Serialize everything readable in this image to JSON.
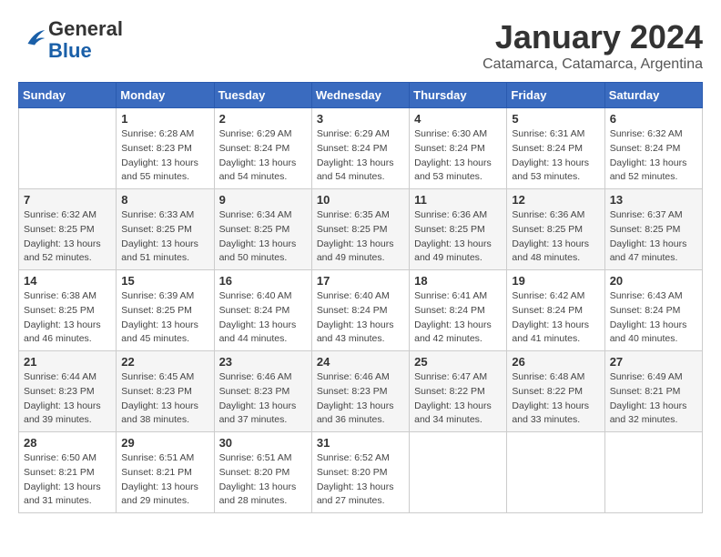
{
  "header": {
    "logo_general": "General",
    "logo_blue": "Blue",
    "title": "January 2024",
    "location": "Catamarca, Catamarca, Argentina"
  },
  "weekdays": [
    "Sunday",
    "Monday",
    "Tuesday",
    "Wednesday",
    "Thursday",
    "Friday",
    "Saturday"
  ],
  "weeks": [
    [
      {
        "day": "",
        "sunrise": "",
        "sunset": "",
        "daylight": ""
      },
      {
        "day": "1",
        "sunrise": "Sunrise: 6:28 AM",
        "sunset": "Sunset: 8:23 PM",
        "daylight": "Daylight: 13 hours and 55 minutes."
      },
      {
        "day": "2",
        "sunrise": "Sunrise: 6:29 AM",
        "sunset": "Sunset: 8:24 PM",
        "daylight": "Daylight: 13 hours and 54 minutes."
      },
      {
        "day": "3",
        "sunrise": "Sunrise: 6:29 AM",
        "sunset": "Sunset: 8:24 PM",
        "daylight": "Daylight: 13 hours and 54 minutes."
      },
      {
        "day": "4",
        "sunrise": "Sunrise: 6:30 AM",
        "sunset": "Sunset: 8:24 PM",
        "daylight": "Daylight: 13 hours and 53 minutes."
      },
      {
        "day": "5",
        "sunrise": "Sunrise: 6:31 AM",
        "sunset": "Sunset: 8:24 PM",
        "daylight": "Daylight: 13 hours and 53 minutes."
      },
      {
        "day": "6",
        "sunrise": "Sunrise: 6:32 AM",
        "sunset": "Sunset: 8:24 PM",
        "daylight": "Daylight: 13 hours and 52 minutes."
      }
    ],
    [
      {
        "day": "7",
        "sunrise": "Sunrise: 6:32 AM",
        "sunset": "Sunset: 8:25 PM",
        "daylight": "Daylight: 13 hours and 52 minutes."
      },
      {
        "day": "8",
        "sunrise": "Sunrise: 6:33 AM",
        "sunset": "Sunset: 8:25 PM",
        "daylight": "Daylight: 13 hours and 51 minutes."
      },
      {
        "day": "9",
        "sunrise": "Sunrise: 6:34 AM",
        "sunset": "Sunset: 8:25 PM",
        "daylight": "Daylight: 13 hours and 50 minutes."
      },
      {
        "day": "10",
        "sunrise": "Sunrise: 6:35 AM",
        "sunset": "Sunset: 8:25 PM",
        "daylight": "Daylight: 13 hours and 49 minutes."
      },
      {
        "day": "11",
        "sunrise": "Sunrise: 6:36 AM",
        "sunset": "Sunset: 8:25 PM",
        "daylight": "Daylight: 13 hours and 49 minutes."
      },
      {
        "day": "12",
        "sunrise": "Sunrise: 6:36 AM",
        "sunset": "Sunset: 8:25 PM",
        "daylight": "Daylight: 13 hours and 48 minutes."
      },
      {
        "day": "13",
        "sunrise": "Sunrise: 6:37 AM",
        "sunset": "Sunset: 8:25 PM",
        "daylight": "Daylight: 13 hours and 47 minutes."
      }
    ],
    [
      {
        "day": "14",
        "sunrise": "Sunrise: 6:38 AM",
        "sunset": "Sunset: 8:25 PM",
        "daylight": "Daylight: 13 hours and 46 minutes."
      },
      {
        "day": "15",
        "sunrise": "Sunrise: 6:39 AM",
        "sunset": "Sunset: 8:25 PM",
        "daylight": "Daylight: 13 hours and 45 minutes."
      },
      {
        "day": "16",
        "sunrise": "Sunrise: 6:40 AM",
        "sunset": "Sunset: 8:24 PM",
        "daylight": "Daylight: 13 hours and 44 minutes."
      },
      {
        "day": "17",
        "sunrise": "Sunrise: 6:40 AM",
        "sunset": "Sunset: 8:24 PM",
        "daylight": "Daylight: 13 hours and 43 minutes."
      },
      {
        "day": "18",
        "sunrise": "Sunrise: 6:41 AM",
        "sunset": "Sunset: 8:24 PM",
        "daylight": "Daylight: 13 hours and 42 minutes."
      },
      {
        "day": "19",
        "sunrise": "Sunrise: 6:42 AM",
        "sunset": "Sunset: 8:24 PM",
        "daylight": "Daylight: 13 hours and 41 minutes."
      },
      {
        "day": "20",
        "sunrise": "Sunrise: 6:43 AM",
        "sunset": "Sunset: 8:24 PM",
        "daylight": "Daylight: 13 hours and 40 minutes."
      }
    ],
    [
      {
        "day": "21",
        "sunrise": "Sunrise: 6:44 AM",
        "sunset": "Sunset: 8:23 PM",
        "daylight": "Daylight: 13 hours and 39 minutes."
      },
      {
        "day": "22",
        "sunrise": "Sunrise: 6:45 AM",
        "sunset": "Sunset: 8:23 PM",
        "daylight": "Daylight: 13 hours and 38 minutes."
      },
      {
        "day": "23",
        "sunrise": "Sunrise: 6:46 AM",
        "sunset": "Sunset: 8:23 PM",
        "daylight": "Daylight: 13 hours and 37 minutes."
      },
      {
        "day": "24",
        "sunrise": "Sunrise: 6:46 AM",
        "sunset": "Sunset: 8:23 PM",
        "daylight": "Daylight: 13 hours and 36 minutes."
      },
      {
        "day": "25",
        "sunrise": "Sunrise: 6:47 AM",
        "sunset": "Sunset: 8:22 PM",
        "daylight": "Daylight: 13 hours and 34 minutes."
      },
      {
        "day": "26",
        "sunrise": "Sunrise: 6:48 AM",
        "sunset": "Sunset: 8:22 PM",
        "daylight": "Daylight: 13 hours and 33 minutes."
      },
      {
        "day": "27",
        "sunrise": "Sunrise: 6:49 AM",
        "sunset": "Sunset: 8:21 PM",
        "daylight": "Daylight: 13 hours and 32 minutes."
      }
    ],
    [
      {
        "day": "28",
        "sunrise": "Sunrise: 6:50 AM",
        "sunset": "Sunset: 8:21 PM",
        "daylight": "Daylight: 13 hours and 31 minutes."
      },
      {
        "day": "29",
        "sunrise": "Sunrise: 6:51 AM",
        "sunset": "Sunset: 8:21 PM",
        "daylight": "Daylight: 13 hours and 29 minutes."
      },
      {
        "day": "30",
        "sunrise": "Sunrise: 6:51 AM",
        "sunset": "Sunset: 8:20 PM",
        "daylight": "Daylight: 13 hours and 28 minutes."
      },
      {
        "day": "31",
        "sunrise": "Sunrise: 6:52 AM",
        "sunset": "Sunset: 8:20 PM",
        "daylight": "Daylight: 13 hours and 27 minutes."
      },
      {
        "day": "",
        "sunrise": "",
        "sunset": "",
        "daylight": ""
      },
      {
        "day": "",
        "sunrise": "",
        "sunset": "",
        "daylight": ""
      },
      {
        "day": "",
        "sunrise": "",
        "sunset": "",
        "daylight": ""
      }
    ]
  ]
}
